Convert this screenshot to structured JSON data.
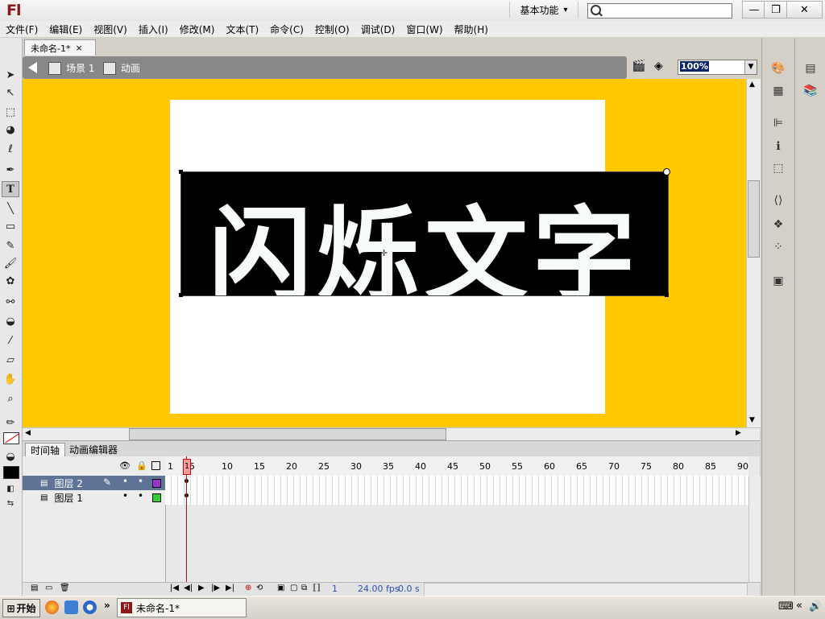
{
  "app": {
    "logo": "Fl",
    "workspace": "基本功能",
    "workspace_arrow": "▾",
    "window_buttons": {
      "minimize": "—",
      "restore": "❐",
      "close": "✕"
    }
  },
  "menu": [
    "文件(F)",
    "编辑(E)",
    "视图(V)",
    "插入(I)",
    "修改(M)",
    "文本(T)",
    "命令(C)",
    "控制(O)",
    "调试(D)",
    "窗口(W)",
    "帮助(H)"
  ],
  "document": {
    "tab_title": "未命名-1*",
    "tab_close": "×"
  },
  "editbar": {
    "scene_label": "场景 1",
    "symbol_label": "动画",
    "zoom": "100%"
  },
  "stage": {
    "text": "闪烁文字",
    "stage_color": "#ffc800",
    "text_color": "#f7fbf7",
    "box_color": "#000000"
  },
  "timeline": {
    "tabs": [
      "时间轴",
      "动画编辑器"
    ],
    "ruler_numbers": [
      "1",
      "5",
      "10",
      "15",
      "20",
      "25",
      "30",
      "35",
      "40",
      "45",
      "50",
      "55",
      "60",
      "65",
      "70",
      "75",
      "80",
      "85",
      "90"
    ],
    "layers": [
      {
        "name": "图层 2",
        "color": "#9933cc",
        "active": true
      },
      {
        "name": "图层 1",
        "color": "#33cc33",
        "active": false
      }
    ],
    "footer": {
      "current_frame": "1",
      "fps": "24.00 fps",
      "time": "0.0 s"
    }
  },
  "taskbar": {
    "start_label": "开始",
    "task_item": "未命名-1*",
    "chevron": "»"
  },
  "icons": {
    "toolbar": [
      "selection-icon",
      "subselection-icon",
      "free-transform-icon",
      "3d-rotation-icon",
      "lasso-icon",
      "pen-icon",
      "text-icon",
      "line-icon",
      "rectangle-icon",
      "pencil-icon",
      "brush-icon",
      "deco-icon",
      "bone-icon",
      "paint-bucket-icon",
      "eyedropper-icon",
      "eraser-icon",
      "hand-icon",
      "zoom-icon"
    ],
    "right_panel": [
      "color-icon",
      "swatches-icon",
      "align-icon",
      "info-icon",
      "transform-icon",
      "code-snippets-icon",
      "components-icon",
      "motion-presets-icon",
      "library-folder-icon"
    ]
  }
}
